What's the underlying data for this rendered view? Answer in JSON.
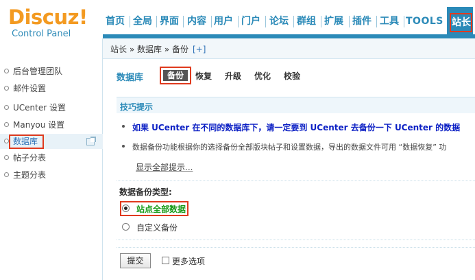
{
  "logo": {
    "main": "Discuz!",
    "sub": "Control Panel"
  },
  "topnav": {
    "items": [
      "首页",
      "全局",
      "界面",
      "内容",
      "用户",
      "门户",
      "论坛",
      "群组",
      "扩展",
      "插件",
      "工具",
      "TOOLS"
    ],
    "active": "站长"
  },
  "sidebar": {
    "items": [
      "后台管理团队",
      "邮件设置",
      "UCenter 设置",
      "Manyou 设置",
      "数据库",
      "帖子分表",
      "主题分表"
    ],
    "active_index": 4
  },
  "breadcrumb": {
    "text": "站长 » 数据库 » 备份",
    "plus": "[+]"
  },
  "subnav": {
    "title": "数据库",
    "active_tab": "备份",
    "tabs": [
      "恢复",
      "升级",
      "优化",
      "校验"
    ]
  },
  "tips": {
    "title": "技巧提示",
    "warn_line": "如果  UCenter 在不同的数据库下，请一定要到  UCenter 去备份一下  UCenter 的数据",
    "info_line": "数据备份功能根据你的选择备份全部版块帖子和设置数据，导出的数据文件可用 “数据恢复” 功",
    "show_all": "显示全部提示..."
  },
  "backup_type": {
    "label": "数据备份类型:",
    "options": [
      {
        "label": "站点全部数据",
        "checked": true
      },
      {
        "label": "自定义备份",
        "checked": false
      }
    ]
  },
  "form": {
    "submit_label": "提交",
    "more_options_label": "更多选项",
    "more_options_checked": false
  },
  "colors": {
    "brand": "#2b8ab8",
    "logo": "#f39a21",
    "highlight": "#e03a1e",
    "warn_text": "#0b1fc4",
    "selected_option": "#1a9b1a"
  }
}
